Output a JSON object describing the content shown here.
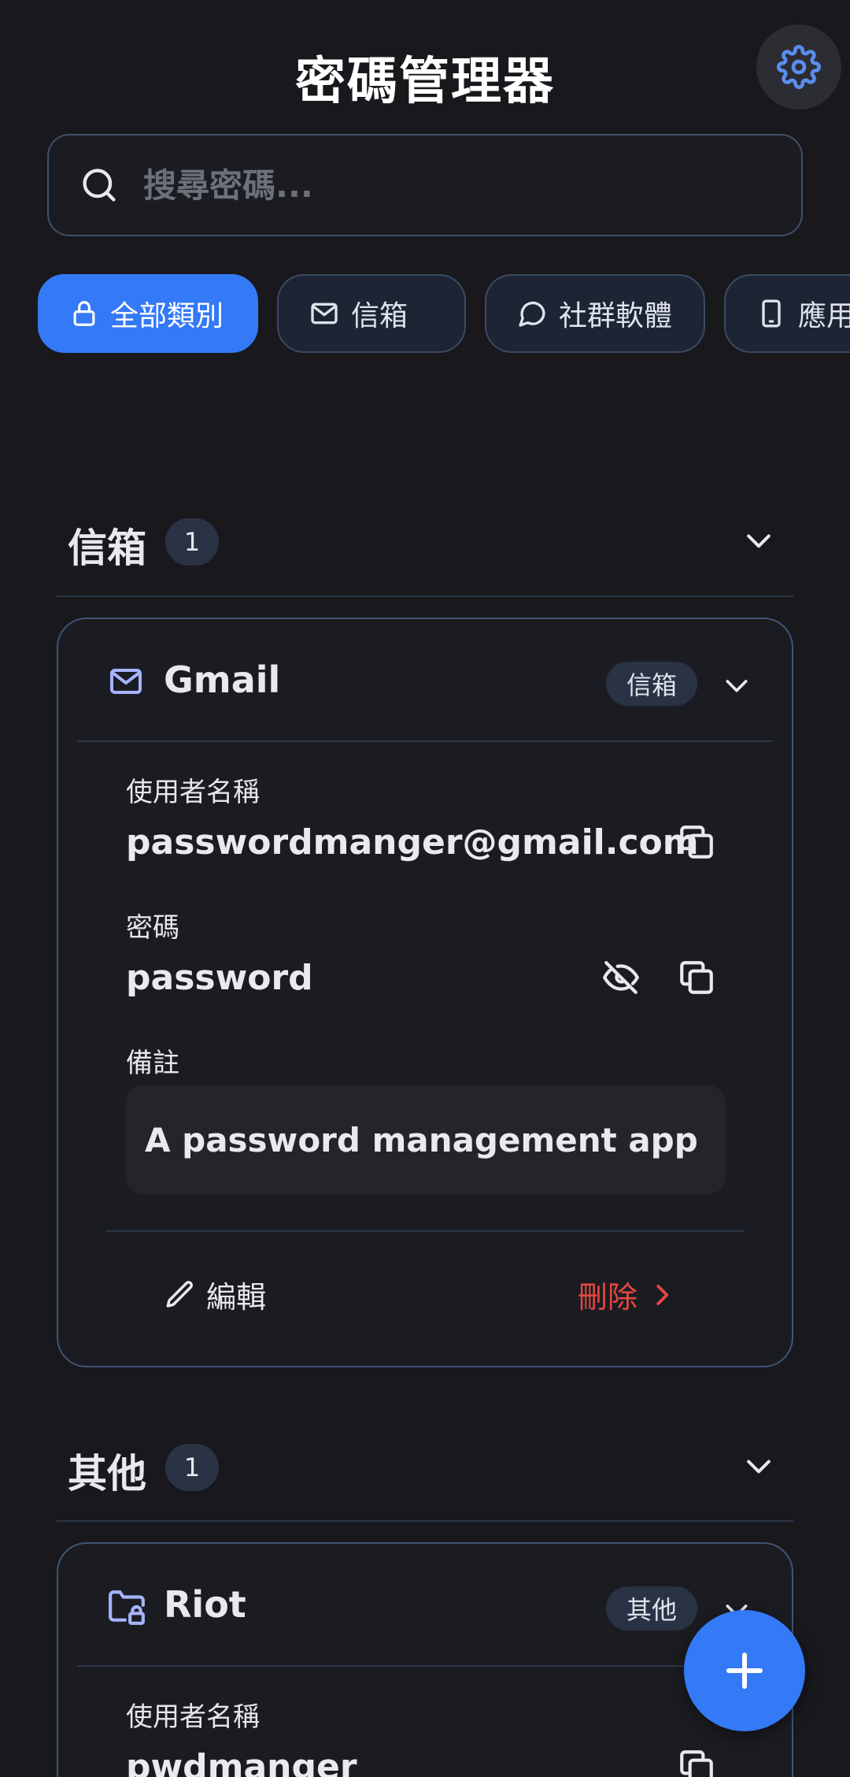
{
  "header": {
    "title": "密碼管理器"
  },
  "search": {
    "placeholder": "搜尋密碼..."
  },
  "categories": [
    {
      "label": "全部類別",
      "icon": "lock-icon",
      "active": true
    },
    {
      "label": "信箱",
      "icon": "mail-icon",
      "active": false
    },
    {
      "label": "社群軟體",
      "icon": "chat-icon",
      "active": false
    },
    {
      "label": "應用",
      "icon": "phone-icon",
      "active": false
    }
  ],
  "sections": [
    {
      "title": "信箱",
      "count": "1",
      "entry": {
        "name": "Gmail",
        "icon": "mail-icon",
        "tag": "信箱",
        "username_label": "使用者名稱",
        "username": "passwordmanger@gmail.com",
        "password_label": "密碼",
        "password": "password",
        "note_label": "備註",
        "note": "A password management app",
        "edit_label": "編輯",
        "delete_label": "刪除"
      }
    },
    {
      "title": "其他",
      "count": "1",
      "entry": {
        "name": "Riot",
        "icon": "folder-lock-icon",
        "tag": "其他",
        "username_label": "使用者名稱",
        "username": "pwdmanger"
      }
    }
  ],
  "colors": {
    "accent": "#3479f6",
    "danger": "#e5483f",
    "icon_purple": "#a5b4fc",
    "background": "#18181d"
  }
}
